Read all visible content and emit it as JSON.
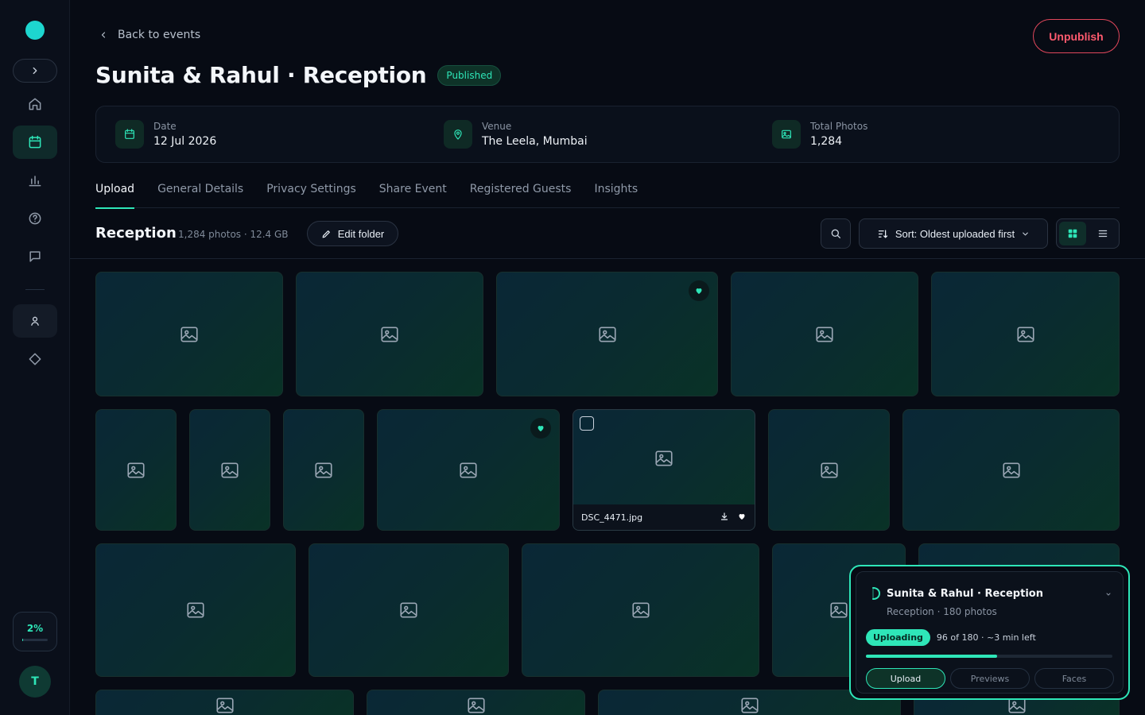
{
  "sidebar": {
    "storage_pct_label": "2%",
    "storage_fraction": 0.04,
    "avatar_initial": "T"
  },
  "header": {
    "back_label": "Back to events",
    "title": "Sunita & Rahul · Reception",
    "status_badge": "Published",
    "unpublish_label": "Unpublish"
  },
  "info": {
    "date_label": "Date",
    "date_value": "12 Jul 2026",
    "venue_label": "Venue",
    "venue_value": "The Leela, Mumbai",
    "photos_label": "Total Photos",
    "photos_value": "1,284"
  },
  "tabs": [
    "Upload",
    "General Details",
    "Privacy Settings",
    "Share Event",
    "Registered Guests",
    "Insights"
  ],
  "toolbar": {
    "folder_name": "Reception",
    "folder_meta": "1,284 photos · 12.4 GB",
    "edit_folder_label": "Edit folder",
    "sort_label": "Sort: Oldest uploaded first"
  },
  "hover_tile": {
    "filename": "DSC_4471.jpg"
  },
  "upload": {
    "title": "Sunita & Rahul · Reception",
    "subtitle": "Reception · 180 photos",
    "status": "Uploading",
    "progress_text": "96 of 180 · ~3 min left",
    "progress_fraction": 0.5333,
    "tabs": [
      "Upload",
      "Previews",
      "Faces"
    ]
  },
  "colors": {
    "accent": "#2ee6b8",
    "danger": "#ff5a6e",
    "background": "#070b14"
  }
}
